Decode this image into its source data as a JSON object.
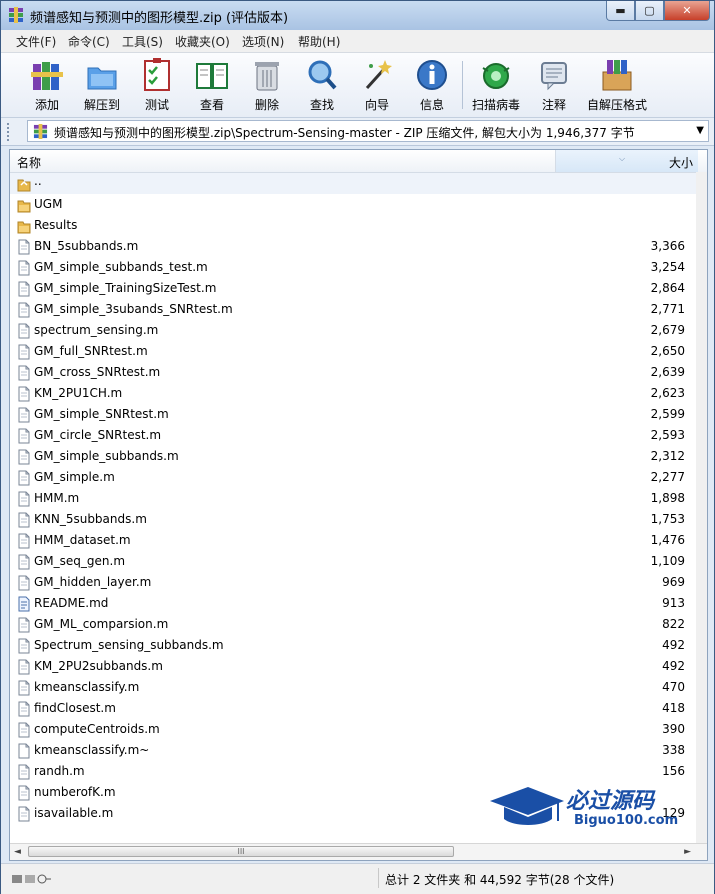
{
  "window": {
    "title": "频谱感知与预测中的图形模型.zip (评估版本)",
    "min_glyph": "▬",
    "max_glyph": "▢",
    "close_glyph": "✕"
  },
  "menu": [
    "文件(F)",
    "命令(C)",
    "工具(S)",
    "收藏夹(O)",
    "选项(N)",
    "帮助(H)"
  ],
  "toolbar": {
    "add": "添加",
    "extract": "解压到",
    "test": "测试",
    "view": "查看",
    "delete": "删除",
    "find": "查找",
    "wizard": "向导",
    "info": "信息",
    "virus": "扫描病毒",
    "comment": "注释",
    "sfx": "自解压格式"
  },
  "address": {
    "path": "频谱感知与预测中的图形模型.zip\\Spectrum-Sensing-master - ZIP 压缩文件, 解包大小为 1,946,377 字节",
    "dropdown": "▼"
  },
  "columns": {
    "name": "名称",
    "size": "大小"
  },
  "files": [
    {
      "name": "..",
      "size": "",
      "type": "up"
    },
    {
      "name": "UGM",
      "size": "",
      "type": "folder"
    },
    {
      "name": "Results",
      "size": "",
      "type": "folder"
    },
    {
      "name": "BN_5subbands.m",
      "size": "3,366",
      "type": "file"
    },
    {
      "name": "GM_simple_subbands_test.m",
      "size": "3,254",
      "type": "file"
    },
    {
      "name": "GM_simple_TrainingSizeTest.m",
      "size": "2,864",
      "type": "file"
    },
    {
      "name": "GM_simple_3subands_SNRtest.m",
      "size": "2,771",
      "type": "file"
    },
    {
      "name": "spectrum_sensing.m",
      "size": "2,679",
      "type": "file"
    },
    {
      "name": "GM_full_SNRtest.m",
      "size": "2,650",
      "type": "file"
    },
    {
      "name": "GM_cross_SNRtest.m",
      "size": "2,639",
      "type": "file"
    },
    {
      "name": "KM_2PU1CH.m",
      "size": "2,623",
      "type": "file"
    },
    {
      "name": "GM_simple_SNRtest.m",
      "size": "2,599",
      "type": "file"
    },
    {
      "name": "GM_circle_SNRtest.m",
      "size": "2,593",
      "type": "file"
    },
    {
      "name": "GM_simple_subbands.m",
      "size": "2,312",
      "type": "file"
    },
    {
      "name": "GM_simple.m",
      "size": "2,277",
      "type": "file"
    },
    {
      "name": "HMM.m",
      "size": "1,898",
      "type": "file"
    },
    {
      "name": "KNN_5subbands.m",
      "size": "1,753",
      "type": "file"
    },
    {
      "name": "HMM_dataset.m",
      "size": "1,476",
      "type": "file"
    },
    {
      "name": "GM_seq_gen.m",
      "size": "1,109",
      "type": "file"
    },
    {
      "name": "GM_hidden_layer.m",
      "size": "969",
      "type": "file"
    },
    {
      "name": "README.md",
      "size": "913",
      "type": "doc"
    },
    {
      "name": "GM_ML_comparsion.m",
      "size": "822",
      "type": "file"
    },
    {
      "name": "Spectrum_sensing_subbands.m",
      "size": "492",
      "type": "file"
    },
    {
      "name": "KM_2PU2subbands.m",
      "size": "492",
      "type": "file"
    },
    {
      "name": "kmeansclassify.m",
      "size": "470",
      "type": "file"
    },
    {
      "name": "findClosest.m",
      "size": "418",
      "type": "file"
    },
    {
      "name": "computeCentroids.m",
      "size": "390",
      "type": "file"
    },
    {
      "name": "kmeansclassify.m~",
      "size": "338",
      "type": "blank"
    },
    {
      "name": "randh.m",
      "size": "156",
      "type": "file"
    },
    {
      "name": "numberofK.m",
      "size": "",
      "type": "file"
    },
    {
      "name": "isavailable.m",
      "size": "129",
      "type": "file"
    }
  ],
  "scroll": {
    "left": "◄",
    "right": "►",
    "thumb": "III"
  },
  "status": {
    "text": "总计 2 文件夹 和 44,592 字节(28 个文件)"
  },
  "watermark": {
    "cn": "必过源码",
    "en": "Biguo100.com"
  },
  "colors": {
    "folder": "#e8b84a",
    "accent": "#1a4fa6",
    "title_bg": "#b9cfeb"
  }
}
